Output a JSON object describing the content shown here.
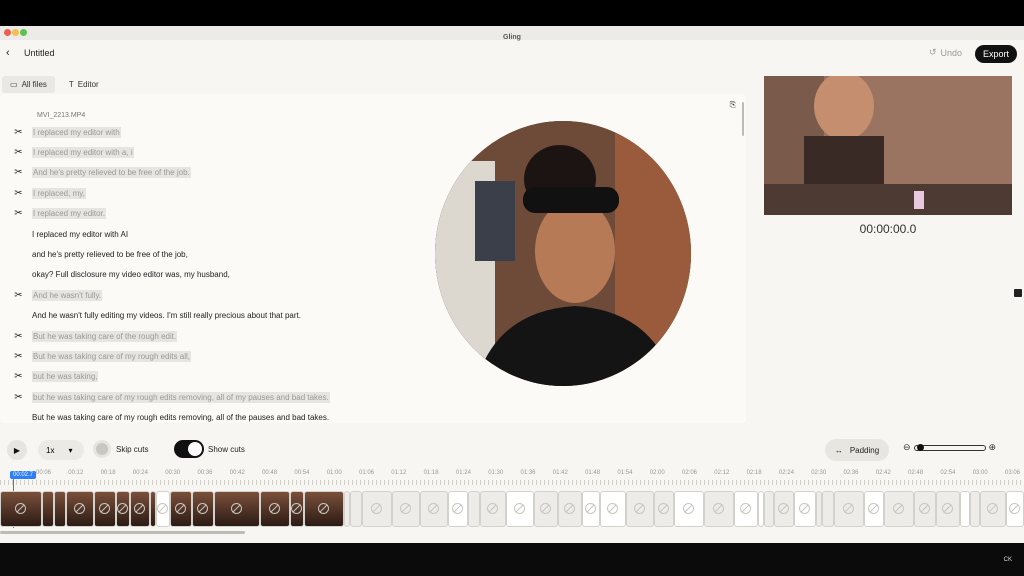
{
  "window": {
    "title": "Gling"
  },
  "header": {
    "back_icon": "chevron-left",
    "doc_title": "Untitled",
    "undo_label": "Undo",
    "export_label": "Export"
  },
  "tabs": [
    {
      "label": "All files",
      "icon": "folder-icon"
    },
    {
      "label": "Editor",
      "icon": "text-icon"
    }
  ],
  "transcript": {
    "filename": "MVI_2213.MP4",
    "lines": [
      {
        "text": "I replaced my editor with",
        "cut": true
      },
      {
        "text": "I replaced my editor with a, i",
        "cut": true
      },
      {
        "text": "And he's pretty relieved to be free of the job.",
        "cut": true
      },
      {
        "text": "I replaced, my,",
        "cut": true
      },
      {
        "text": "I replaced my editor.",
        "cut": true
      },
      {
        "text": "I replaced my editor with AI",
        "cut": false
      },
      {
        "text": "and he's pretty relieved to be free of the job,",
        "cut": false
      },
      {
        "text": "okay? Full disclosure my video editor was, my husband,",
        "cut": false
      },
      {
        "text": "And he wasn't fully.",
        "cut": true
      },
      {
        "text": "And he wasn't fully editing my videos. I'm still really precious about that part.",
        "cut": false
      },
      {
        "text": "But he was taking care of the rough edit.",
        "cut": true
      },
      {
        "text": "But he was taking care of my rough edits all,",
        "cut": true
      },
      {
        "text": "but he was taking,",
        "cut": true
      },
      {
        "text": "but he was taking care of my rough edits removing, all of my pauses and bad takes.",
        "cut": true
      },
      {
        "text": "But he was taking care of my rough edits removing, all of the pauses and bad takes.",
        "cut": false
      }
    ]
  },
  "preview": {
    "timecode": "00:00:00.0"
  },
  "controls": {
    "speed": "1x",
    "skip_cuts_label": "Skip cuts",
    "show_cuts_label": "Show cuts",
    "show_cuts_on": true,
    "padding_label": "Padding"
  },
  "timeline": {
    "playhead": "00:02.7",
    "ticks": [
      "00:06",
      "00:12",
      "00:18",
      "00:24",
      "00:30",
      "00:36",
      "00:42",
      "00:48",
      "00:54",
      "01:00",
      "01:06",
      "01:12",
      "01:18",
      "01:24",
      "01:30",
      "01:36",
      "01:42",
      "01:48",
      "01:54",
      "02:00",
      "02:06",
      "02:12",
      "02:18",
      "02:24",
      "02:30",
      "02:36",
      "02:42",
      "02:48",
      "02:54",
      "03:00",
      "03:06"
    ]
  },
  "watermark": "CK",
  "colors": {
    "accent": "#2d7ff9",
    "export_bg": "#111111",
    "cut_bg": "#e6e5e1"
  }
}
